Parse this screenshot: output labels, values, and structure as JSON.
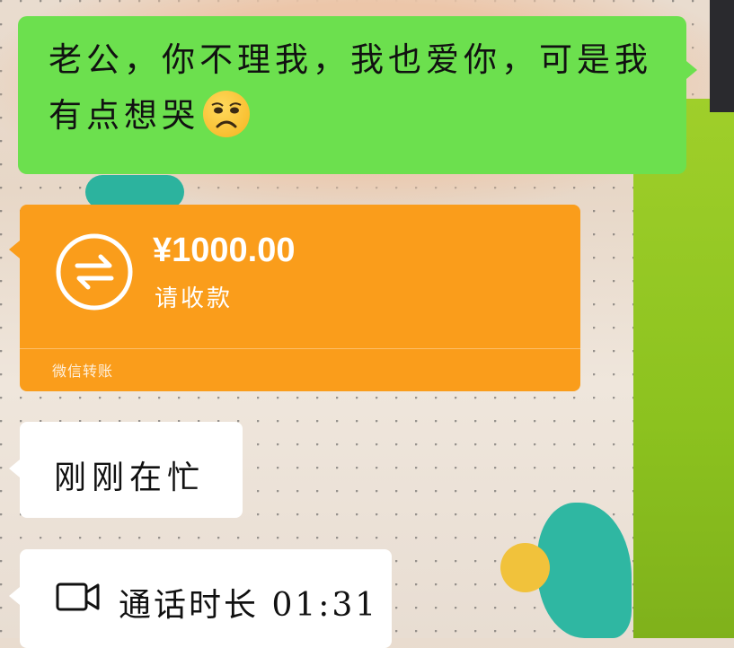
{
  "messages": {
    "sent_text": "老公，你不理我，我也爱你，可是我有点想哭",
    "emoji": "frowning-face-emoji",
    "transfer": {
      "amount": "¥1000.00",
      "subtitle": "请收款",
      "footer": "微信转账"
    },
    "reply_text": "刚刚在忙",
    "call": {
      "label": "通话时长 01:31",
      "icon": "video-call-icon"
    }
  },
  "colors": {
    "sent_bubble": "#6ce04e",
    "transfer_bubble": "#fa9d1b",
    "received_bubble": "#ffffff"
  }
}
